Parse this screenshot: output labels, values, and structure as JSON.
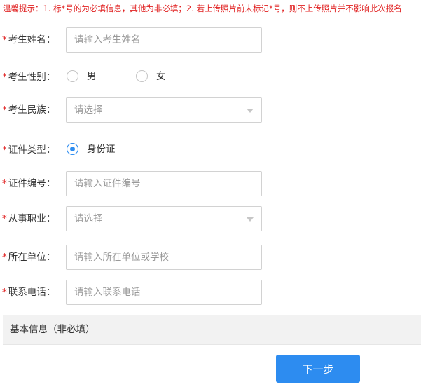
{
  "notice": "温馨提示：1. 标*号的为必填信息，其他为非必填；2. 若上传照片前未标记*号，则不上传照片并不影响此次报名",
  "required_mark": "*",
  "form": {
    "name": {
      "label": "考生姓名：",
      "placeholder": "请输入考生姓名"
    },
    "gender": {
      "label": "考生性别：",
      "options": [
        "男",
        "女"
      ],
      "selected": ""
    },
    "ethnicity": {
      "label": "考生民族：",
      "value": "请选择"
    },
    "id_type": {
      "label": "证件类型：",
      "options": [
        "身份证"
      ],
      "selected": "身份证"
    },
    "id_number": {
      "label": "证件编号：",
      "placeholder": "请输入证件编号"
    },
    "occupation": {
      "label": "从事职业：",
      "value": "请选择"
    },
    "employer": {
      "label": "所在单位：",
      "placeholder": "请输入所在单位或学校"
    },
    "phone": {
      "label": "联系电话：",
      "placeholder": "请输入联系电话"
    }
  },
  "section_basic_info": "基本信息（非必填）",
  "next_button": "下一步",
  "colors": {
    "accent": "#2d8cf0",
    "required": "#e02020",
    "section_bg": "#f2f2f2"
  }
}
